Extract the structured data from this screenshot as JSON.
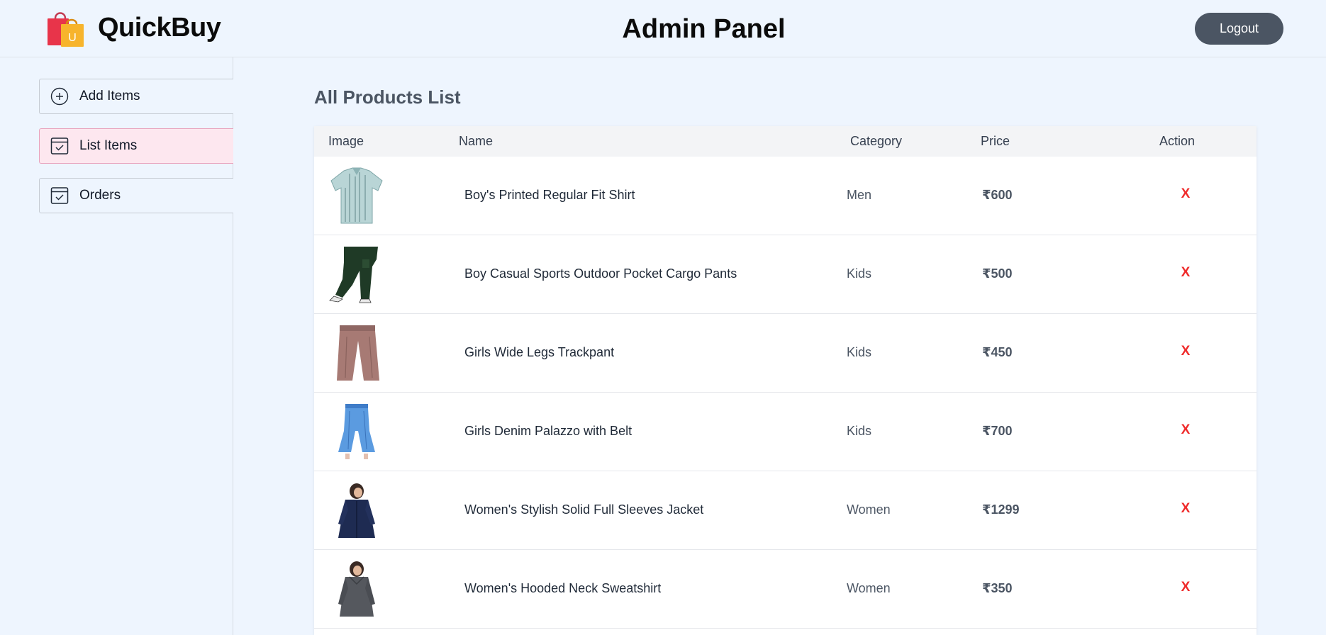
{
  "header": {
    "brand": "QuickBuy",
    "logo_icon": "shopping-bag-icon",
    "logo_letter": "U",
    "title": "Admin Panel",
    "logout_label": "Logout"
  },
  "sidebar": {
    "items": [
      {
        "label": "Add Items",
        "icon": "plus-circle-icon",
        "active": false
      },
      {
        "label": "List Items",
        "icon": "checkbox-icon",
        "active": true
      },
      {
        "label": "Orders",
        "icon": "checkbox-icon",
        "active": false
      }
    ]
  },
  "main": {
    "title": "All Products List",
    "columns": [
      "Image",
      "Name",
      "Category",
      "Price",
      "Action"
    ],
    "rows": [
      {
        "image": "shirt-image",
        "name": "Boy's Printed Regular Fit Shirt",
        "category": "Men",
        "price": "₹600",
        "action": "X"
      },
      {
        "image": "cargo-pants-image",
        "name": "Boy Casual Sports Outdoor Pocket Cargo Pants",
        "category": "Kids",
        "price": "₹500",
        "action": "X"
      },
      {
        "image": "trackpant-image",
        "name": "Girls Wide Legs Trackpant",
        "category": "Kids",
        "price": "₹450",
        "action": "X"
      },
      {
        "image": "palazzo-image",
        "name": "Girls Denim Palazzo with Belt",
        "category": "Kids",
        "price": "₹700",
        "action": "X"
      },
      {
        "image": "jacket-image",
        "name": "Women's Stylish Solid Full Sleeves Jacket",
        "category": "Women",
        "price": "₹1299",
        "action": "X"
      }
    ]
  },
  "partial_row": {
    "image": "sweatshirt-image",
    "name": "Women's Hooded Neck Sweatshirt",
    "category": "Women",
    "price": "₹350",
    "action": "X"
  },
  "colors": {
    "background": "#eef5fe",
    "active_item": "#fde7ef",
    "logout_button": "#4b5563",
    "delete": "#ef2b2b"
  }
}
